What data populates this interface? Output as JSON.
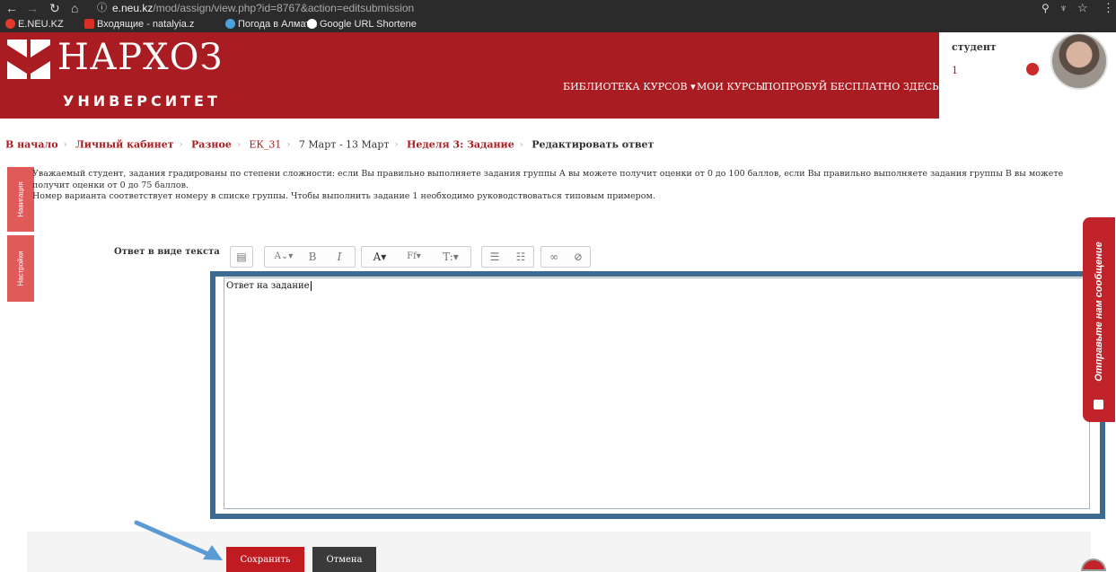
{
  "browser": {
    "url_host": "e.neu.kz",
    "url_path": "/mod/assign/view.php?id=8767&action=editsubmission",
    "bookmarks": [
      {
        "label": "E.NEU.KZ",
        "color": "#e23b2e"
      },
      {
        "label": "Входящие - natalyia.z",
        "color": "#d93025"
      },
      {
        "label": "Погода в Алматы",
        "color": "#4aa3df"
      },
      {
        "label": "Google URL Shortene",
        "color": "#ffffff"
      }
    ]
  },
  "header": {
    "logo_title": "НАРХОЗ",
    "logo_subtitle": "УНИВЕРСИТЕТ",
    "menu": [
      "БИБЛИОТЕКА КУРСОВ ▾",
      "МОИ КУРСЫ",
      "ПОПРОБУЙ БЕСПЛАТНО ЗДЕСЬ!"
    ],
    "user_role": "студент",
    "user_number": "1",
    "brand_color": "#a91d22"
  },
  "breadcrumb": {
    "home": "В начало",
    "cabinet": "Личный кабинет",
    "misc": "Разное",
    "course": "ЕК_31",
    "dates": "7 Март - 13 Март",
    "week": "Неделя 3: Задание",
    "current": "Редактировать ответ"
  },
  "sidetabs": {
    "navigation": "Навигация",
    "settings": "Настройки"
  },
  "intro": {
    "line1": "Уважаемый студент, задания градированы по степени сложности: если Вы правильно выполняете задания группы А вы можете получит оценки от 0 до 100 баллов, если Вы правильно выполняете задания группы В вы можете получит оценки от 0 до 75 баллов.",
    "line2": "Номер варианта соответствует номеру в списке группы. Чтобы выполнить задание 1 необходимо руководствоваться типовым примером."
  },
  "form": {
    "answer_label": "Ответ в виде текста",
    "editor_text": "Ответ на задание",
    "toolbar_glyphs": {
      "bold": "B",
      "italic": "I",
      "font": "Ff",
      "size": "T:",
      "style": "A"
    }
  },
  "feedback": {
    "label": "Отправьте нам сообщение"
  },
  "buttons": {
    "save": "Сохранить",
    "cancel": "Отмена"
  }
}
